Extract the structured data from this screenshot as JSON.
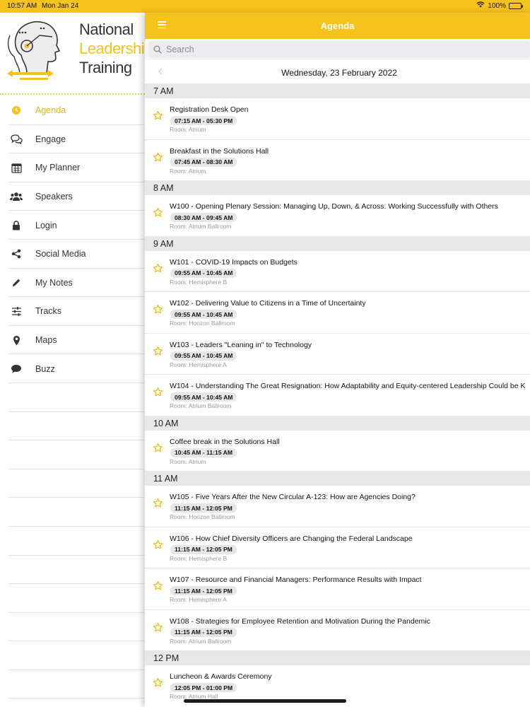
{
  "status_bar": {
    "time": "10:57 AM",
    "date": "Mon Jan 24",
    "battery": "100%"
  },
  "app": {
    "logo_line1": "National",
    "logo_line2": "Leadership",
    "logo_line3": "Training",
    "accent_color": "#f6c21c"
  },
  "sidebar": {
    "items": [
      {
        "label": "Agenda",
        "icon": "clock-icon",
        "active": true
      },
      {
        "label": "Engage",
        "icon": "chat-bubbles-icon"
      },
      {
        "label": "My Planner",
        "icon": "calendar-icon"
      },
      {
        "label": "Speakers",
        "icon": "people-icon"
      },
      {
        "label": "Login",
        "icon": "lock-icon"
      },
      {
        "label": "Social Media",
        "icon": "share-icon"
      },
      {
        "label": "My Notes",
        "icon": "pencil-icon"
      },
      {
        "label": "Tracks",
        "icon": "sliders-icon"
      },
      {
        "label": "Maps",
        "icon": "map-pin-icon"
      },
      {
        "label": "Buzz",
        "icon": "speech-bubble-icon"
      }
    ]
  },
  "header": {
    "title": "Agenda"
  },
  "search": {
    "placeholder": "Search"
  },
  "date_nav": {
    "date": "Wednesday, 23 February 2022"
  },
  "agenda": {
    "groups": [
      {
        "hour": "7 AM",
        "sessions": [
          {
            "title": "Registration Desk Open",
            "time": "07:15 AM - 05:30 PM",
            "room": "Room:  Atrium"
          },
          {
            "title": "Breakfast in the Solutions Hall",
            "time": "07:45 AM - 08:30 AM",
            "room": "Room:  Atrium"
          }
        ]
      },
      {
        "hour": "8 AM",
        "sessions": [
          {
            "title": "W100 - Opening Plenary Session: Managing Up, Down, & Across: Working Successfully with Others",
            "time": "08:30 AM - 09:45 AM",
            "room": "Room:  Atrium Ballroom"
          }
        ]
      },
      {
        "hour": "9 AM",
        "sessions": [
          {
            "title": "W101 - COVID-19 Impacts on Budgets",
            "time": "09:55 AM - 10:45 AM",
            "room": "Room:  Hemisphere B"
          },
          {
            "title": "W102 -  Delivering Value to Citizens in a Time of Uncertainty",
            "time": "09:55 AM - 10:45 AM",
            "room": "Room:  Horizon Ballroom"
          },
          {
            "title": "W103 - Leaders \"Leaning in\" to Technology",
            "time": "09:55 AM - 10:45 AM",
            "room": "Room:  Hemisphere A"
          },
          {
            "title": "W104 - Understanding The Great Resignation: How Adaptability and Equity-centered Leadership Could be K",
            "time": "09:55 AM - 10:45 AM",
            "room": "Room:  Atrium Ballroom"
          }
        ]
      },
      {
        "hour": "10 AM",
        "sessions": [
          {
            "title": "Coffee break in the Solutions Hall",
            "time": "10:45 AM - 11:15 AM",
            "room": "Room:  Atrium"
          }
        ]
      },
      {
        "hour": "11 AM",
        "sessions": [
          {
            "title": "W105 - Five Years After the New Circular A-123: How are Agencies Doing?",
            "time": "11:15 AM - 12:05 PM",
            "room": "Room:  Horizon Ballroom"
          },
          {
            "title": "W106 - How Chief Diversity Officers are Changing the Federal Landscape",
            "time": "11:15 AM - 12:05 PM",
            "room": "Room:  Hemisphere B"
          },
          {
            "title": "W107 - Resource and Financial Managers: Performance Results with Impact",
            "time": "11:15 AM - 12:05 PM",
            "room": "Room:  Hemisphere A"
          },
          {
            "title": "W108 - Strategies for Employee Retention and Motivation During the Pandemic",
            "time": "11:15 AM - 12:05 PM",
            "room": "Room:  Atrium Ballroom"
          }
        ]
      },
      {
        "hour": "12 PM",
        "sessions": [
          {
            "title": "Luncheon & Awards Ceremony",
            "time": "12:05 PM - 01:00 PM",
            "room": "Room:  Atrium Hall"
          }
        ]
      }
    ]
  }
}
